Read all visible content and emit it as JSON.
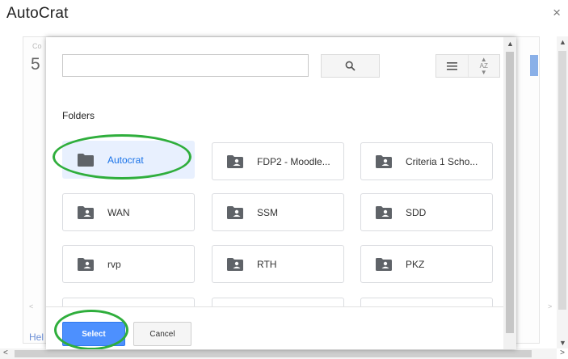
{
  "window": {
    "title": "AutoCrat",
    "close_glyph": "×"
  },
  "background": {
    "small_label": "Co",
    "step_number": "5",
    "help_text": "Hel"
  },
  "picker": {
    "search": {
      "value": "",
      "placeholder": ""
    },
    "folders_label": "Folders",
    "folders": [
      {
        "name": "Autocrat",
        "type": "folder",
        "selected": true
      },
      {
        "name": "FDP2 - Moodle...",
        "type": "shared-folder",
        "selected": false
      },
      {
        "name": "Criteria 1 Scho...",
        "type": "shared-folder",
        "selected": false
      },
      {
        "name": "WAN",
        "type": "shared-folder",
        "selected": false
      },
      {
        "name": "SSM",
        "type": "shared-folder",
        "selected": false
      },
      {
        "name": "SDD",
        "type": "shared-folder",
        "selected": false
      },
      {
        "name": "rvp",
        "type": "shared-folder",
        "selected": false
      },
      {
        "name": "RTH",
        "type": "shared-folder",
        "selected": false
      },
      {
        "name": "PKZ",
        "type": "shared-folder",
        "selected": false
      }
    ],
    "select_label": "Select",
    "cancel_label": "Cancel"
  },
  "colors": {
    "accent": "#4d90fe",
    "selected_bg": "#e8f0fe",
    "annotation": "#2fae3c"
  }
}
